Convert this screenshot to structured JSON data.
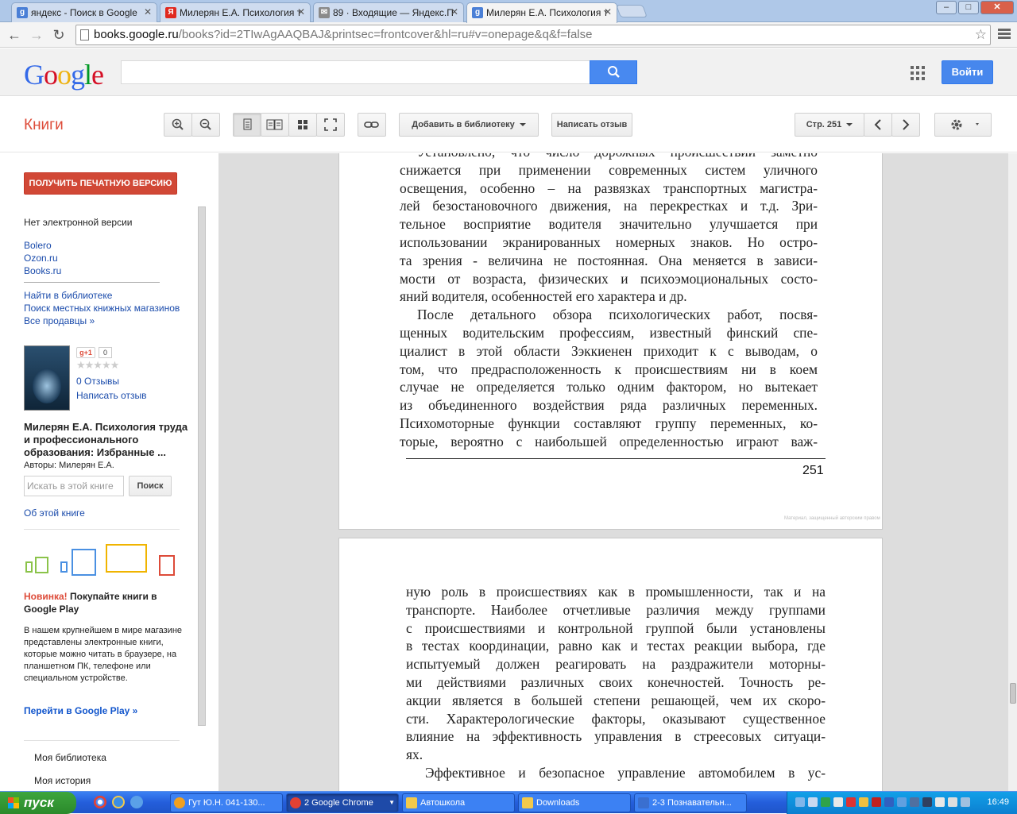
{
  "browser": {
    "tabs": [
      {
        "title": "яндекс - Поиск в Google",
        "icon": "google-g-icon",
        "icon_color": "#4a7fd6",
        "icon_glyph": "g"
      },
      {
        "title": "Милерян Е.А. Психология т",
        "icon": "yandex-icon",
        "icon_color": "#e0291f",
        "icon_glyph": "Я"
      },
      {
        "title": "89 · Входящие — Яндекс.П",
        "icon": "mail-icon",
        "icon_color": "#8a8a8a",
        "icon_glyph": "✉"
      },
      {
        "title": "Милерян Е.А. Психология т",
        "icon": "google-g-icon",
        "icon_color": "#4a7fd6",
        "icon_glyph": "g"
      }
    ],
    "url_host": "books.google.ru",
    "url_rest": "/books?id=2TIwAgAAQBAJ&printsec=frontcover&hl=ru#v=onepage&q&f=false",
    "window_buttons": {
      "minimize": "–",
      "maximize": "□",
      "close": "✕"
    }
  },
  "header": {
    "logo": [
      "G",
      "o",
      "o",
      "g",
      "l",
      "e"
    ],
    "logo_colors": [
      "#3369e8",
      "#d50f25",
      "#eeb211",
      "#3369e8",
      "#009925",
      "#d50f25"
    ],
    "signin_label": "Войти"
  },
  "books_bar": {
    "title": "Книги",
    "add_to_library": "Добавить в библиотеку",
    "write_review": "Написать отзыв",
    "page_label": "Стр. 251"
  },
  "sidebar": {
    "buy_button": "ПОЛУЧИТЬ ПЕЧАТНУЮ ВЕРСИЮ",
    "no_ebook": "Нет электронной версии",
    "stores": [
      "Bolero",
      "Ozon.ru",
      "Books.ru"
    ],
    "links": [
      "Найти в библиотеке",
      "Поиск местных книжных магазинов",
      "Все продавцы »"
    ],
    "gplus_label": "g+1",
    "gplus_count": "0",
    "reviews": "0 Отзывы",
    "write_review": "Написать отзыв",
    "book_title": "Милерян Е.А. Психология труда и профессионального образования: Избранные ...",
    "authors": "Авторы: Милерян Е.А.",
    "search_placeholder": "Искать в этой книге",
    "search_button": "Поиск",
    "about": "Об этой книге",
    "promo_new": "Новинка!",
    "promo_title": " Покупайте книги в Google Play",
    "promo_body": "В нашем крупнейшем в мире магазине представлены электронные книги, которые можно читать в браузере, на планшетном ПК, телефоне или специальном устройстве.",
    "play_link": "Перейти в Google Play »",
    "my_library": "Моя библиотека",
    "my_history": "Моя история"
  },
  "viewer": {
    "page1_lines": [
      "Установлено, что число дорожных происшествий заметно",
      "снижается при применении современных систем уличного",
      "освещения, особенно – на развязках транспортных магистра-",
      "лей безостановочного движения, на  перекрестках и т.д. Зри-",
      "тельное восприятие водителя значительно улучшается при",
      "использовании экранированных номерных знаков. Но остро-",
      "та зрения - величина не постоянная. Она меняется в зависи-",
      "мости от возраста, физических и психоэмоциональных состо-",
      "яний водителя, особенностей его характера и др.",
      "После детального обзора психологических работ, посвя-",
      "щенных водительским профессиям, известный финский спе-",
      "циалист в этой области Зэккиенен приходит к с выводам, о",
      "том, что предрасположенность к происшествиям ни в коем",
      "случае не определяется только одним фактором, но вытекает",
      "из объединенного воздействия ряда различных переменных.",
      "Психомоторные функции составляют группу переменных, ко-",
      "торые, вероятно с наибольшей определенностью играют важ-"
    ],
    "page1_number": "251",
    "copyright": "Материал, защищенный авторским правом",
    "page2_lines": [
      "ную роль в происшествиях как в промышленности, так и на",
      "транспорте. Наиболее отчетливые различия между группами",
      "с происшествиями и контрольной группой были установлены",
      "в тестах координации, равно как и тестах реакции выбора, где",
      "испытуемый должен реагировать на раздражители моторны-",
      "ми действиями различных своих конечностей. Точность ре-",
      "акции является в большей степени решающей, чем их скоро-",
      "сти. Характерологические факторы, оказывают существенное",
      "влияние на эффективность управления в стреесовых ситуаци-",
      "ях.",
      "Эффективное и безопасное управление автомобилем в ус-"
    ]
  },
  "taskbar": {
    "start": "пуск",
    "tasks": [
      {
        "label": "Гут Ю.Н. 041-130...",
        "icon_color": "#f0a020"
      },
      {
        "label": "2 Google Chrome",
        "icon_color": "#e34133"
      },
      {
        "label": "Автошкола",
        "icon_color": "#f2c94c"
      },
      {
        "label": "Downloads",
        "icon_color": "#f2c94c"
      },
      {
        "label": "2-3 Познавательн...",
        "icon_color": "#3a6fd0"
      }
    ],
    "clock": "16:49"
  }
}
